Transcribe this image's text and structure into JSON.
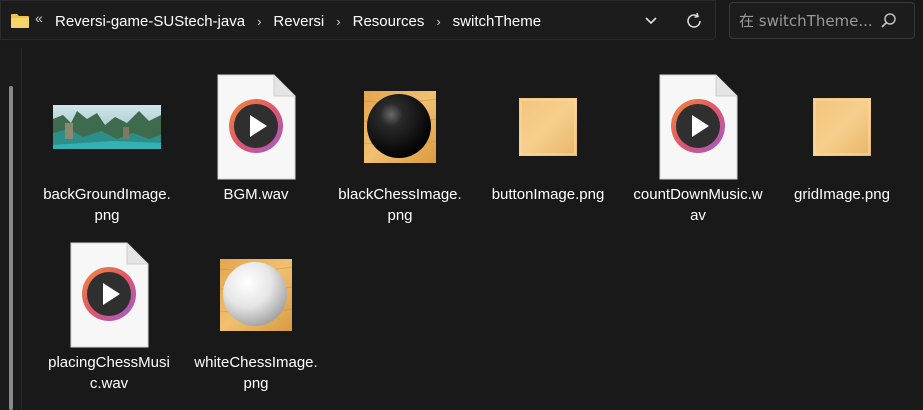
{
  "address_bar": {
    "overflow_label": "«",
    "breadcrumbs": [
      "Reversi-game-SUStech-java",
      "Reversi",
      "Resources",
      "switchTheme"
    ],
    "separator": "›"
  },
  "search": {
    "placeholder": "在 switchTheme..."
  },
  "files": [
    {
      "name": "backGroundImage.png",
      "thumbnail": "landscape-image"
    },
    {
      "name": "BGM.wav",
      "thumbnail": "audio-file-icon"
    },
    {
      "name": "blackChessImage.png",
      "thumbnail": "black-chess-image"
    },
    {
      "name": "buttonImage.png",
      "thumbnail": "wood-tile-image"
    },
    {
      "name": "countDownMusic.wav",
      "thumbnail": "audio-file-icon"
    },
    {
      "name": "gridImage.png",
      "thumbnail": "wood-tile-image"
    },
    {
      "name": "placingChessMusic.wav",
      "thumbnail": "audio-file-icon"
    },
    {
      "name": "whiteChessImage.png",
      "thumbnail": "white-chess-image"
    }
  ],
  "colors": {
    "background": "#191919",
    "text": "#ffffff",
    "folder": "#f0c24a",
    "wood": "#e8b765",
    "play_ring": "#e06b4a"
  }
}
